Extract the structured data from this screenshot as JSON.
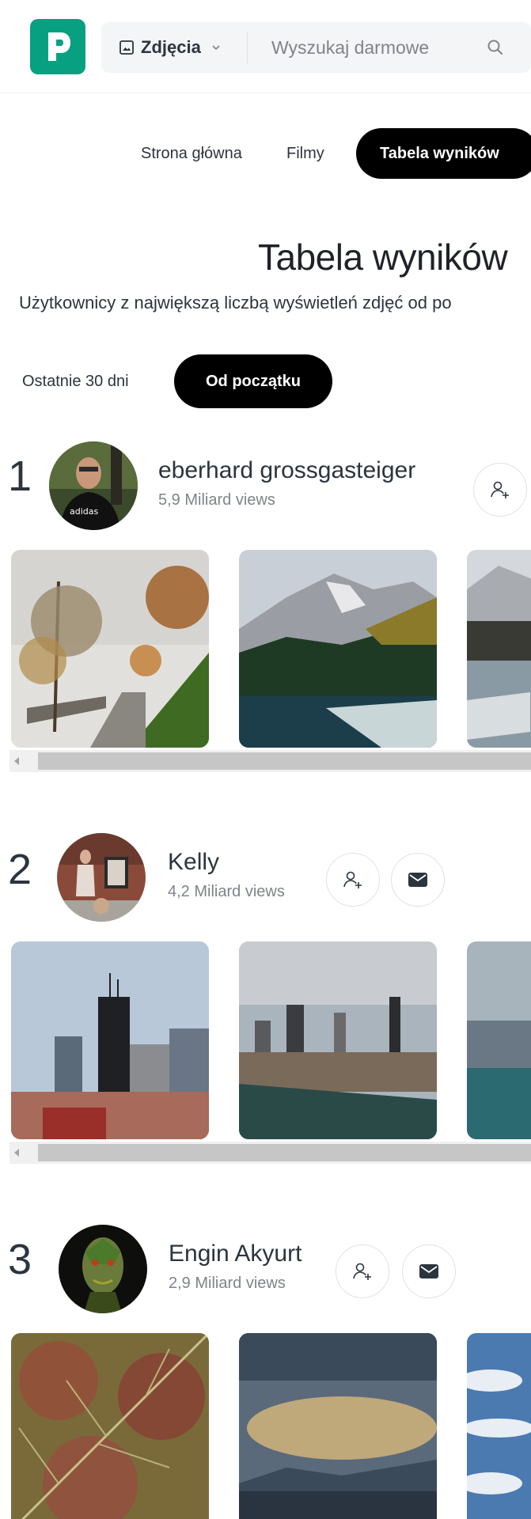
{
  "header": {
    "logo_letter": "P",
    "search": {
      "type_label": "Zdjęcia",
      "placeholder": "Wyszukaj darmowe"
    }
  },
  "nav": {
    "tabs": [
      {
        "label": "Strona główna"
      },
      {
        "label": "Filmy"
      },
      {
        "label": "Tabela wyników",
        "active": true
      }
    ]
  },
  "page": {
    "title": "Tabela wyników",
    "subtitle": "Użytkownicy z największą liczbą wyświetleń zdjęć od po"
  },
  "periods": [
    {
      "label": "Ostatnie 30 dni"
    },
    {
      "label": "Od początku",
      "active": true
    }
  ],
  "entries": [
    {
      "rank": "1",
      "name": "eberhard grossgasteiger",
      "views": "5,9 Miliard views",
      "photos": [
        "autumn-path",
        "mountain-lake",
        "winter-lake"
      ]
    },
    {
      "rank": "2",
      "name": "Kelly",
      "views": "4,2 Miliard views",
      "photos": [
        "city-towers",
        "city-skyline",
        "city-harbor"
      ]
    },
    {
      "rank": "3",
      "name": "Engin Akyurt",
      "views": "2,9 Miliard views",
      "photos": [
        "autumn-leaf",
        "sunset-sea",
        "sky-clouds"
      ]
    }
  ],
  "colors": {
    "brand": "#07a081",
    "active_pill": "#000000"
  }
}
